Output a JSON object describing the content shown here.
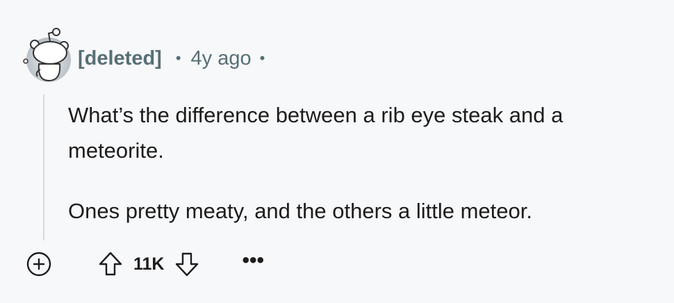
{
  "comment": {
    "author": "[deleted]",
    "separator": "•",
    "time_ago": "4y ago",
    "trailing_separator": "•",
    "body": [
      "What’s the difference between a rib eye steak and a meteorite.",
      "Ones pretty meaty, and the others a little meteor."
    ]
  },
  "actions": {
    "score": "11K",
    "more_label": "•••"
  },
  "icons": {
    "avatar": "snoo-avatar-icon",
    "expand": "plus-circle-icon",
    "upvote": "arrow-up-icon",
    "downvote": "arrow-down-icon",
    "more": "ellipsis-icon"
  },
  "colors": {
    "background": "#f7f8fa",
    "meta_text": "#576f76",
    "body_text": "#1c1c1c",
    "thread_line": "#d6dadc"
  }
}
